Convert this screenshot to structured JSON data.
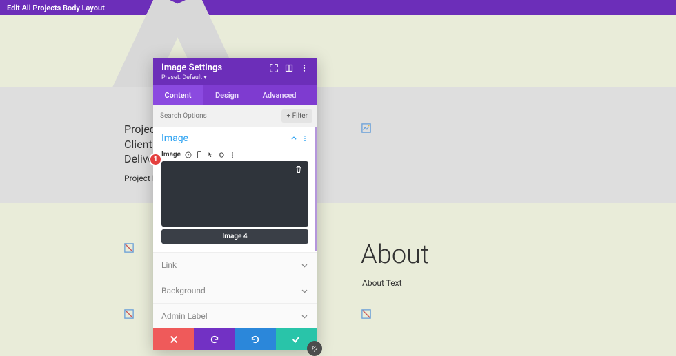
{
  "topbar": {
    "title": "Edit All Projects Body Layout"
  },
  "page": {
    "left_lines": [
      "Projec",
      "Client",
      "Delive"
    ],
    "left_sub": "Project I",
    "about_heading": "About",
    "about_text": "About Text"
  },
  "modal": {
    "title": "Image Settings",
    "preset": "Preset: Default ▾",
    "tabs": [
      "Content",
      "Design",
      "Advanced"
    ],
    "active_tab_index": 0,
    "search_placeholder": "Search Options",
    "filter_label": "+ Filter",
    "sections": {
      "image": {
        "title": "Image",
        "field_label": "Image",
        "preview_caption": "Image 4"
      },
      "collapsed": [
        "Link",
        "Background",
        "Admin Label"
      ]
    },
    "badge": "1"
  }
}
